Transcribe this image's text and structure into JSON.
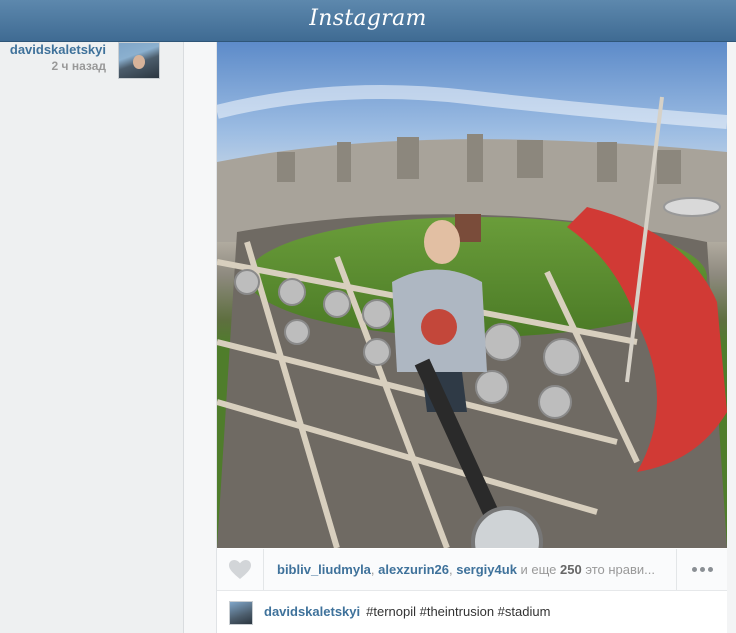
{
  "header": {
    "logo": "Instagram"
  },
  "post": {
    "author": "davidskaletskyi",
    "time_ago": "2 ч назад",
    "likes": {
      "users": [
        "bibliv_liudmyla",
        "alexzurin26",
        "sergiy4uk"
      ],
      "sep1": ", ",
      "sep2": ", ",
      "and_more": " и еще ",
      "count": "250",
      "suffix": " это нрави..."
    },
    "caption": {
      "user": "davidskaletskyi",
      "text": "#ternopil #theintrusion #stadium"
    }
  },
  "icons": {
    "like": "heart-icon",
    "more": "more-dots-icon"
  },
  "colors": {
    "header": "#4f7ba2",
    "link": "#3f729b",
    "muted": "#999999"
  }
}
